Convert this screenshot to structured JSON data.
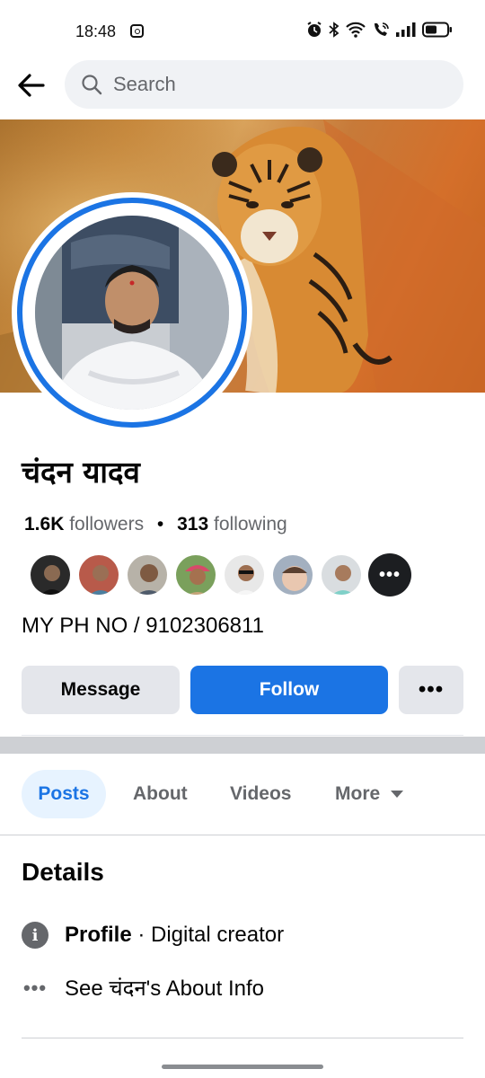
{
  "status_bar": {
    "time": "18:48"
  },
  "search": {
    "placeholder": "Search"
  },
  "profile": {
    "name": "चंदन यादव",
    "followers_count": "1.6K",
    "followers_label": "followers",
    "separator": "•",
    "following_count": "313",
    "following_label": "following",
    "bio": "MY PH NO / 9102306811",
    "more_friends_glyph": "•••"
  },
  "actions": {
    "message_label": "Message",
    "follow_label": "Follow",
    "more_glyph": "•••"
  },
  "tabs": [
    {
      "label": "Posts"
    },
    {
      "label": "About"
    },
    {
      "label": "Videos"
    },
    {
      "label": "More"
    }
  ],
  "details": {
    "title": "Details",
    "profile_label": "Profile",
    "profile_value": " · Digital creator",
    "about_link": "See चंदन's About Info",
    "info_glyph": "i",
    "dots_glyph": "•••"
  },
  "colors": {
    "accent": "#1b74e4",
    "accent_light": "#e7f3ff",
    "button_gray": "#e4e6eb",
    "text_secondary": "#65676b"
  },
  "icons": [
    "back-arrow-icon",
    "search-icon",
    "info-icon",
    "more-dots-icon",
    "caret-down-icon",
    "alarm-icon",
    "bluetooth-icon",
    "wifi-icon",
    "wifi-call-icon",
    "signal-icon",
    "battery-icon",
    "instagram-icon"
  ]
}
